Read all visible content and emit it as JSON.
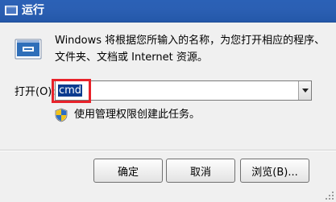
{
  "window": {
    "title": "运行"
  },
  "dialog": {
    "description_line1": "Windows 将根据您所输入的名称，为您打开相应的程序、",
    "description_line2": "文件夹、文档或 Internet 资源。",
    "open_label": "打开(O):",
    "command_value": "cmd",
    "admin_note": "使用管理权限创建此任务。"
  },
  "buttons": {
    "ok": "确定",
    "cancel": "取消",
    "browse": "浏览(B)..."
  },
  "icons": {
    "title": "run-icon",
    "run": "run-dialog-icon",
    "admin": "uac-shield-icon",
    "dropdown": "chevron-down-icon"
  },
  "colors": {
    "titlebar": "#2b5fb3",
    "dialog_bg": "#f0f0f0",
    "highlight_box": "#e8222a",
    "selection": "#0a3b8f"
  }
}
